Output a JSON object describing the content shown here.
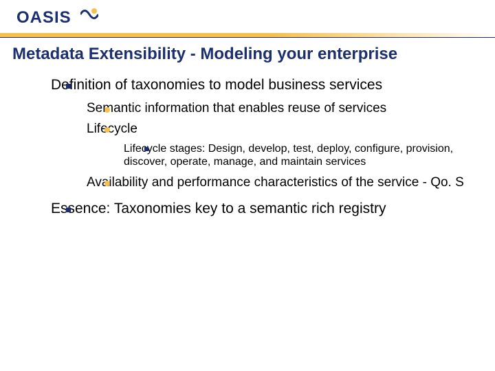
{
  "logo": {
    "text": "OASIS"
  },
  "title": "Metadata Extensibility - Modeling your enterprise",
  "bullets": [
    {
      "text": "Definition of taxonomies to model business services",
      "children": [
        {
          "text": "Semantic information that enables reuse of services"
        },
        {
          "text": "Lifecycle",
          "children": [
            {
              "text": "Lifecycle stages: Design, develop, test, deploy, configure, provision, discover, operate, manage, and maintain services"
            }
          ]
        },
        {
          "text": "Availability and performance characteristics of the service - Qo. S"
        }
      ]
    },
    {
      "text": "Essence: Taxonomies key to a semantic rich registry"
    }
  ]
}
